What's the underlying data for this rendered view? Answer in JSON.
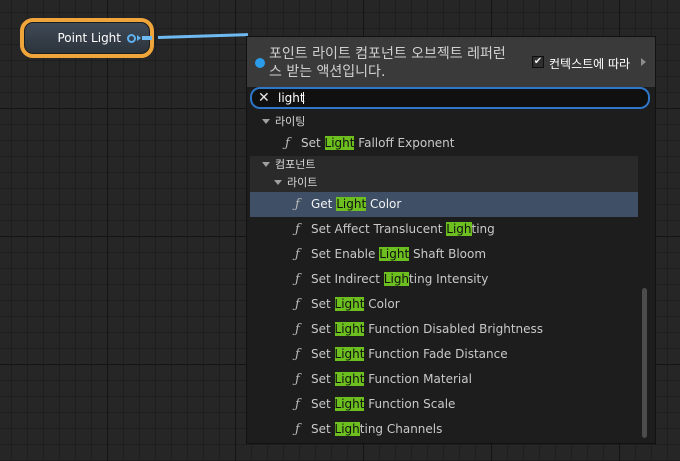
{
  "node": {
    "label": "Point Light"
  },
  "panel": {
    "title": "포인트 라이트 컴포넌트 오브젝트 레퍼런스 받는 액션입니다.",
    "context_sensitive": {
      "label": "컨텍스트에 따라",
      "checked": true
    }
  },
  "search": {
    "value": "light",
    "highlight_color": "#6cbf1f"
  },
  "categories": {
    "lighting": "라이팅",
    "component": "컴포넌트",
    "light": "라이트"
  },
  "items": [
    {
      "pre": "Set ",
      "hl": "Light",
      "post": " Falloff Exponent"
    },
    {
      "pre": "Get ",
      "hl": "Light",
      "post": " Color"
    },
    {
      "pre": "Set Affect Translucent ",
      "hl": "Ligh",
      "post": "ting"
    },
    {
      "pre": "Set Enable ",
      "hl": "Light",
      "post": " Shaft Bloom"
    },
    {
      "pre": "Set Indirect ",
      "hl": "Ligh",
      "post": "ting Intensity"
    },
    {
      "pre": "Set ",
      "hl": "Light",
      "post": " Color"
    },
    {
      "pre": "Set ",
      "hl": "Light",
      "post": " Function Disabled Brightness"
    },
    {
      "pre": "Set ",
      "hl": "Light",
      "post": " Function Fade Distance"
    },
    {
      "pre": "Set ",
      "hl": "Light",
      "post": " Function Material"
    },
    {
      "pre": "Set ",
      "hl": "Light",
      "post": " Function Scale"
    },
    {
      "pre": "Set ",
      "hl": "Ligh",
      "post": "ting Channels"
    }
  ],
  "selected_item": "Get Light Color",
  "colors": {
    "accent": "#2d76c8",
    "selection": "#3e4f66",
    "node_border": "#f0a53a",
    "wire": "#6fbaf2"
  }
}
